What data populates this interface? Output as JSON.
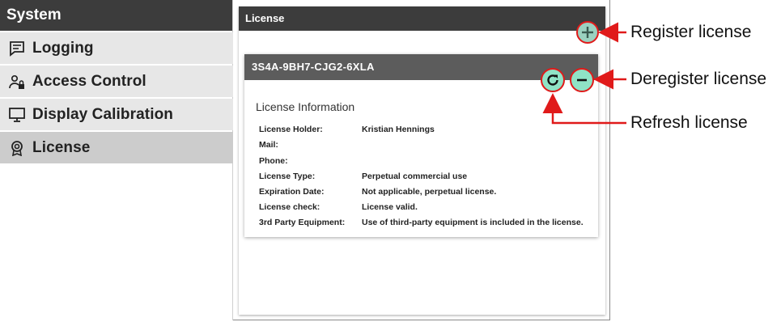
{
  "sidebar": {
    "header": "System",
    "items": [
      {
        "label": "Logging",
        "icon": "message-icon"
      },
      {
        "label": "Access Control",
        "icon": "user-lock-icon"
      },
      {
        "label": "Display Calibration",
        "icon": "monitor-icon"
      },
      {
        "label": "License",
        "icon": "badge-icon",
        "active": true
      }
    ]
  },
  "panel": {
    "title": "License",
    "add_icon": "plus-icon"
  },
  "card": {
    "license_key": "3S4A-9BH7-CJG2-6XLA",
    "section_title": "License Information",
    "rows": [
      {
        "label": "License Holder:",
        "value": "Kristian Hennings"
      },
      {
        "label": "Mail:",
        "value": ""
      },
      {
        "label": "Phone:",
        "value": ""
      },
      {
        "label": "License Type:",
        "value": "Perpetual commercial use"
      },
      {
        "label": "Expiration Date:",
        "value": "Not applicable, perpetual license."
      },
      {
        "label": "License check:",
        "value": "License valid."
      },
      {
        "label": "3rd Party Equipment:",
        "value": "Use of third-party equipment is included in the license."
      }
    ]
  },
  "annotations": {
    "register": "Register license",
    "deregister": "Deregister license",
    "refresh": "Refresh license"
  },
  "colors": {
    "header_bg": "#3c3c3c",
    "card_header_bg": "#5c5c5c",
    "button_fill": "#8fe3c6",
    "highlight": "#e01a1a"
  }
}
